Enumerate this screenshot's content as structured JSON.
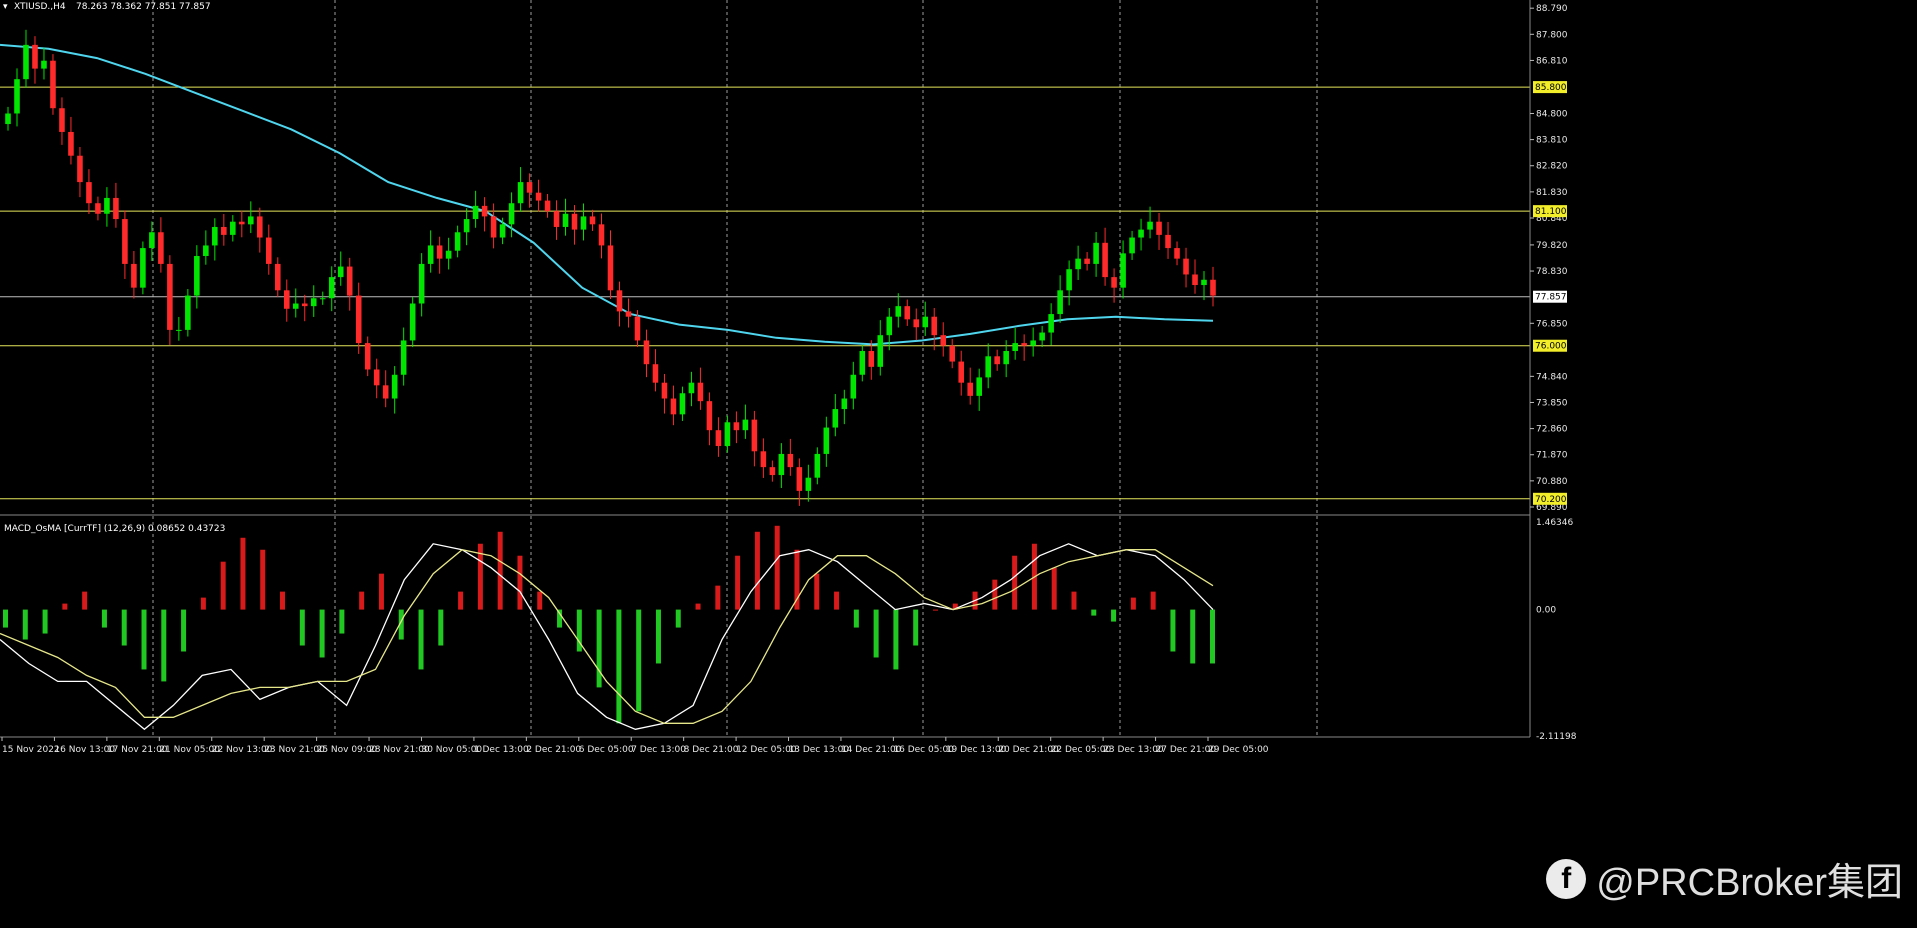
{
  "header": {
    "symbol": "XTIUSD.,H4",
    "ohlc": "78.263 78.362 77.851 77.857"
  },
  "indicator": {
    "label": "MACD_OsMA [CurrTF] (12,26,9) 0.08652 0.43723",
    "axis_labels": [
      "1.46346",
      "0.00",
      "-2.11198"
    ]
  },
  "price_axis": {
    "labels": [
      "88.790",
      "87.800",
      "86.810",
      "84.800",
      "83.810",
      "82.820",
      "81.830",
      "80.840",
      "79.820",
      "78.830",
      "76.850",
      "74.840",
      "73.850",
      "72.860",
      "71.870",
      "70.880",
      "69.890"
    ],
    "level_badges": [
      "85.800",
      "81.100",
      "77.857",
      "76.000",
      "70.200"
    ]
  },
  "time_axis": {
    "labels": [
      "15 Nov 2022",
      "16 Nov 13:00",
      "17 Nov 21:00",
      "21 Nov 05:00",
      "22 Nov 13:00",
      "23 Nov 21:00",
      "25 Nov 09:00",
      "28 Nov 21:00",
      "30 Nov 05:00",
      "1 Dec 13:00",
      "2 Dec 21:00",
      "6 Dec 05:00",
      "7 Dec 13:00",
      "8 Dec 21:00",
      "12 Dec 05:00",
      "13 Dec 13:00",
      "14 Dec 21:00",
      "16 Dec 05:00",
      "19 Dec 13:00",
      "20 Dec 21:00",
      "22 Dec 05:00",
      "23 Dec 13:00",
      "27 Dec 21:00",
      "29 Dec 05:00"
    ]
  },
  "watermark": {
    "text": "@PRCBroker集团",
    "icon": "facebook-icon"
  },
  "colors": {
    "background": "#000000",
    "bull": "#00e600",
    "bear": "#ff2a2a",
    "level": "#e6e65a",
    "ma": "#4fd6ee",
    "macd_pos": "#d91a1a",
    "macd_neg": "#22c822",
    "signal_white": "#ffffff",
    "signal_yellow": "#e6e68a"
  },
  "chart_data": [
    {
      "type": "candlestick",
      "title": "XTIUSD.,H4",
      "ylim": [
        69.7,
        89.1
      ],
      "levels": [
        85.8,
        81.1,
        77.857,
        76.0,
        70.2
      ],
      "close_path": [
        84.8,
        86.1,
        87.4,
        86.5,
        86.8,
        85.0,
        84.1,
        83.2,
        82.2,
        81.4,
        81.0,
        81.6,
        80.8,
        79.1,
        78.2,
        79.7,
        80.3,
        79.1,
        76.6,
        76.6,
        77.9,
        79.4,
        79.8,
        80.5,
        80.2,
        80.7,
        80.6,
        80.9,
        80.1,
        79.1,
        78.1,
        77.4,
        77.6,
        77.5,
        77.8,
        77.8,
        78.6,
        79.0,
        77.9,
        76.1,
        75.1,
        74.5,
        74.0,
        74.9,
        76.2,
        77.6,
        79.1,
        79.8,
        79.3,
        79.6,
        80.3,
        80.8,
        81.3,
        80.9,
        80.1,
        80.6,
        81.4,
        82.2,
        81.8,
        81.5,
        81.1,
        80.5,
        81.0,
        80.4,
        80.9,
        80.6,
        79.8,
        78.1,
        77.3,
        77.1,
        76.2,
        75.3,
        74.6,
        74.0,
        73.4,
        74.2,
        74.6,
        73.9,
        72.8,
        72.2,
        73.1,
        72.8,
        73.2,
        72.0,
        71.4,
        71.1,
        71.9,
        71.4,
        70.5,
        71.0,
        71.9,
        72.9,
        73.6,
        74.0,
        74.9,
        75.8,
        75.2,
        76.4,
        77.1,
        77.5,
        77.0,
        76.7,
        77.1,
        76.4,
        76.0,
        75.4,
        74.6,
        74.1,
        74.8,
        75.6,
        75.3,
        75.8,
        76.1,
        76.0,
        76.2,
        76.5,
        77.2,
        78.1,
        78.9,
        79.3,
        79.1,
        79.9,
        78.6,
        78.2,
        79.5,
        80.1,
        80.4,
        80.7,
        80.2,
        79.7,
        79.3,
        78.7,
        78.3,
        78.5,
        77.9
      ],
      "ma_path": [
        87.4,
        87.25,
        86.9,
        86.3,
        85.6,
        84.9,
        84.2,
        83.3,
        82.2,
        81.6,
        81.1,
        79.9,
        78.2,
        77.2,
        76.8,
        76.6,
        76.3,
        76.15,
        76.05,
        76.2,
        76.45,
        76.75,
        77.0,
        77.1,
        77.0,
        76.95
      ]
    },
    {
      "type": "bar",
      "title": "MACD_OsMA [CurrTF] (12,26,9) 0.08652 0.43723",
      "ylim": [
        -2.11198,
        1.46346
      ],
      "histogram_path": [
        -0.3,
        -0.5,
        -0.4,
        0.1,
        0.3,
        -0.3,
        -0.6,
        -1.0,
        -1.2,
        -0.7,
        0.2,
        0.8,
        1.2,
        1.0,
        0.3,
        -0.6,
        -0.8,
        -0.4,
        0.3,
        0.6,
        -0.5,
        -1.0,
        -0.6,
        0.3,
        1.1,
        1.3,
        0.9,
        0.3,
        -0.3,
        -0.7,
        -1.3,
        -1.9,
        -1.7,
        -0.9,
        -0.3,
        0.1,
        0.4,
        0.9,
        1.3,
        1.4,
        1.0,
        0.6,
        0.3,
        -0.3,
        -0.8,
        -1.0,
        -0.6,
        0.0,
        0.1,
        0.3,
        0.5,
        0.9,
        1.1,
        0.7,
        0.3,
        -0.1,
        -0.2,
        0.2,
        0.3,
        -0.7,
        -0.9,
        -0.9
      ],
      "macd_path": [
        -0.5,
        -0.9,
        -1.2,
        -1.2,
        -1.6,
        -2.0,
        -1.6,
        -1.1,
        -1.0,
        -1.5,
        -1.3,
        -1.2,
        -1.6,
        -0.6,
        0.5,
        1.1,
        1.0,
        0.7,
        0.3,
        -0.5,
        -1.4,
        -1.8,
        -2.0,
        -1.9,
        -1.6,
        -0.5,
        0.3,
        0.9,
        1.0,
        0.8,
        0.4,
        0.0,
        0.1,
        0.0,
        0.2,
        0.5,
        0.9,
        1.1,
        0.9,
        1.0,
        0.9,
        0.5,
        0.0
      ],
      "signal_path": [
        -0.4,
        -0.6,
        -0.8,
        -1.1,
        -1.3,
        -1.8,
        -1.8,
        -1.6,
        -1.4,
        -1.3,
        -1.3,
        -1.2,
        -1.2,
        -1.0,
        -0.1,
        0.6,
        1.0,
        0.9,
        0.6,
        0.2,
        -0.5,
        -1.2,
        -1.7,
        -1.9,
        -1.9,
        -1.7,
        -1.2,
        -0.3,
        0.5,
        0.9,
        0.9,
        0.6,
        0.2,
        0.0,
        0.1,
        0.3,
        0.6,
        0.8,
        0.9,
        1.0,
        1.0,
        0.7,
        0.4
      ]
    }
  ]
}
